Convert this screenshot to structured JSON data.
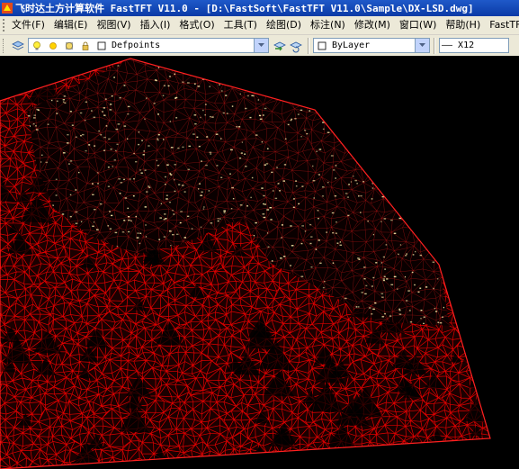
{
  "window": {
    "title": "飞时达土方计算软件 FastTFT V11.0 - [D:\\FastSoft\\FastTFT V11.0\\Sample\\DX-LSD.dwg]",
    "app_icon": "fasttft-logo-icon"
  },
  "menubar": {
    "items": [
      {
        "label": "文件(F)",
        "name": "file"
      },
      {
        "label": "编辑(E)",
        "name": "edit"
      },
      {
        "label": "视图(V)",
        "name": "view"
      },
      {
        "label": "插入(I)",
        "name": "insert"
      },
      {
        "label": "格式(O)",
        "name": "format"
      },
      {
        "label": "工具(T)",
        "name": "tools"
      },
      {
        "label": "绘图(D)",
        "name": "draw"
      },
      {
        "label": "标注(N)",
        "name": "dimension"
      },
      {
        "label": "修改(M)",
        "name": "modify"
      },
      {
        "label": "窗口(W)",
        "name": "window"
      },
      {
        "label": "帮助(H)",
        "name": "help"
      },
      {
        "label": "FastTFT",
        "name": "fasttft"
      }
    ]
  },
  "toolbar": {
    "layer_combo_value": "Defpoints",
    "color_combo_value": "ByLayer",
    "linetype_combo_value": "—— X12"
  },
  "canvas": {
    "background": "#000000",
    "mesh_color": "#e80000",
    "point_color": "#f0e0a0"
  }
}
